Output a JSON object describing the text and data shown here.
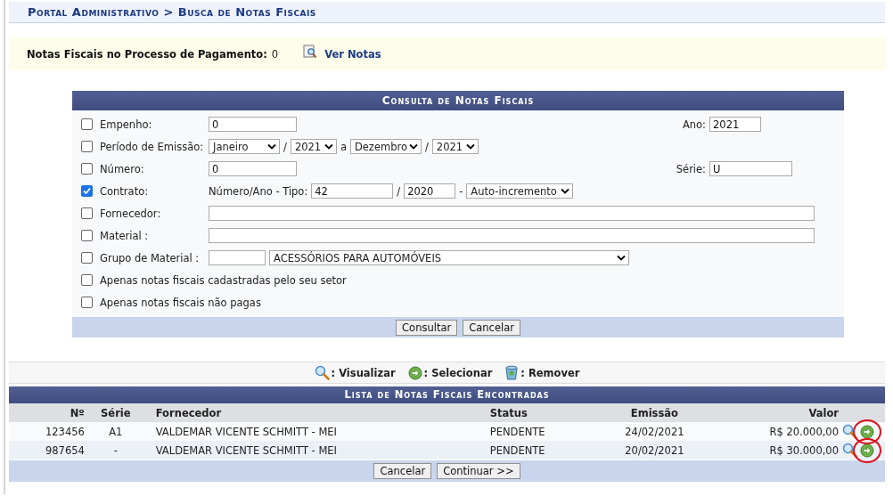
{
  "breadcrumb": "Portal Administrativo > Busca de Notas Fiscais",
  "payment_notice": {
    "label": "Notas Fiscais no Processo de Pagamento:",
    "count": "0",
    "link": "Ver Notas"
  },
  "form": {
    "title": "Consulta de Notas Fiscais",
    "rows": [
      {
        "kind": "field",
        "checked": false,
        "label": "Empenho:",
        "controls": [
          {
            "kind": "input",
            "value": "0"
          }
        ],
        "right": {
          "label": "Ano:",
          "value": "2021"
        }
      },
      {
        "kind": "field",
        "checked": false,
        "label": "Período de Emissão:",
        "controls": [
          {
            "kind": "select-month",
            "value": "Janeiro"
          },
          {
            "kind": "text",
            "text": "/"
          },
          {
            "kind": "select-year",
            "value": "2021"
          },
          {
            "kind": "text",
            "text": "a"
          },
          {
            "kind": "select-month",
            "value": "Dezembro"
          },
          {
            "kind": "text",
            "text": "/"
          },
          {
            "kind": "select-year",
            "value": "2021"
          }
        ]
      },
      {
        "kind": "field",
        "checked": false,
        "label": "Número:",
        "controls": [
          {
            "kind": "input",
            "value": "0"
          }
        ],
        "right": {
          "label": "Série:",
          "value": "U"
        }
      },
      {
        "kind": "field",
        "checked": true,
        "label": "Contrato:",
        "controls": [
          {
            "kind": "text",
            "text": "Número/Ano - Tipo:"
          },
          {
            "kind": "input-number",
            "value": "42"
          },
          {
            "kind": "text",
            "text": "/"
          },
          {
            "kind": "input-year",
            "value": "2020"
          },
          {
            "kind": "text",
            "text": "-"
          },
          {
            "kind": "select",
            "value": "Auto-incremento"
          }
        ]
      },
      {
        "kind": "field",
        "checked": false,
        "label": "Fornecedor:",
        "controls": [
          {
            "kind": "input-full"
          }
        ]
      },
      {
        "kind": "field",
        "checked": false,
        "label": "Material :",
        "controls": [
          {
            "kind": "input-full"
          }
        ]
      },
      {
        "kind": "field",
        "checked": false,
        "label": "Grupo de Material :",
        "controls": [
          {
            "kind": "input-code"
          },
          {
            "kind": "select-wide",
            "value": "ACESSÓRIOS PARA AUTOMÓVEIS"
          }
        ]
      },
      {
        "kind": "option",
        "checked": false,
        "label": "Apenas notas fiscais cadastradas pelo seu setor"
      },
      {
        "kind": "option",
        "checked": false,
        "label": "Apenas notas fiscais não pagas"
      }
    ],
    "buttons": [
      "Consultar",
      "Cancelar"
    ]
  },
  "legend": [
    {
      "kind": "view",
      "label": ": Visualizar"
    },
    {
      "kind": "select",
      "label": ": Selecionar"
    },
    {
      "kind": "remove",
      "label": ": Remover"
    }
  ],
  "results": {
    "title": "Lista de Notas Fiscais Encontradas",
    "columns": [
      "Nº",
      "Série",
      "Fornecedor",
      "Status",
      "Emissão",
      "Valor"
    ],
    "rows": [
      {
        "cells": [
          "123456",
          "A1",
          "VALDEMAR VICENTE SCHMITT - MEI",
          "PENDENTE",
          "24/02/2021",
          "R$ 20.000,00"
        ],
        "circled": true
      },
      {
        "cells": [
          "987654",
          "-",
          "VALDEMAR VICENTE SCHMITT - MEI",
          "PENDENTE",
          "20/02/2021",
          "R$ 30.000,00"
        ],
        "circled": true
      }
    ],
    "buttons": [
      "Cancelar",
      "Continuar >>"
    ]
  }
}
